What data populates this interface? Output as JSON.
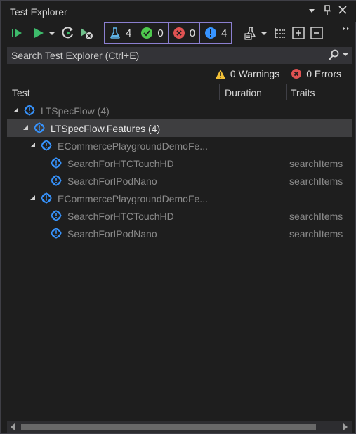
{
  "window": {
    "title": "Test Explorer",
    "controls": {
      "dropdown": "▾",
      "pin": "📌",
      "close": "✕"
    }
  },
  "toolbar": {
    "counters": [
      {
        "kind": "total",
        "icon": "flask-icon",
        "value": "4"
      },
      {
        "kind": "passed",
        "icon": "check-circle-icon",
        "value": "0",
        "color": "#4ec94e"
      },
      {
        "kind": "failed",
        "icon": "x-circle-icon",
        "value": "0",
        "color": "#e05252"
      },
      {
        "kind": "not-run",
        "icon": "info-circle-icon",
        "value": "4",
        "color": "#3794ff"
      }
    ]
  },
  "search": {
    "placeholder": "Search Test Explorer (Ctrl+E)"
  },
  "status": {
    "warnings": "0 Warnings",
    "errors": "0 Errors"
  },
  "columns": {
    "test": "Test",
    "duration": "Duration",
    "traits": "Traits"
  },
  "tree": [
    {
      "label": "LTSpecFlow  (4)",
      "trait": "",
      "level": 0,
      "expanded": true,
      "selected": false
    },
    {
      "label": "LTSpecFlow.Features  (4)",
      "trait": "",
      "level": 1,
      "expanded": true,
      "selected": true
    },
    {
      "label": "ECommercePlaygroundDemoFe...",
      "trait": "",
      "level": 2,
      "expanded": true,
      "selected": false
    },
    {
      "label": "SearchForHTCTouchHD",
      "trait": "searchItems",
      "level": 3,
      "expanded": null,
      "selected": false
    },
    {
      "label": "SearchForIPodNano",
      "trait": "searchItems",
      "level": 3,
      "expanded": null,
      "selected": false
    },
    {
      "label": "ECommercePlaygroundDemoFe...",
      "trait": "",
      "level": 2,
      "expanded": true,
      "selected": false
    },
    {
      "label": "SearchForHTCTouchHD",
      "trait": "searchItems",
      "level": 3,
      "expanded": null,
      "selected": false
    },
    {
      "label": "SearchForIPodNano",
      "trait": "searchItems",
      "level": 3,
      "expanded": null,
      "selected": false
    }
  ],
  "colors": {
    "accent": "#8b7fd0",
    "background": "#1e1e1e",
    "selection": "#3e3e40",
    "info": "#3794ff"
  }
}
